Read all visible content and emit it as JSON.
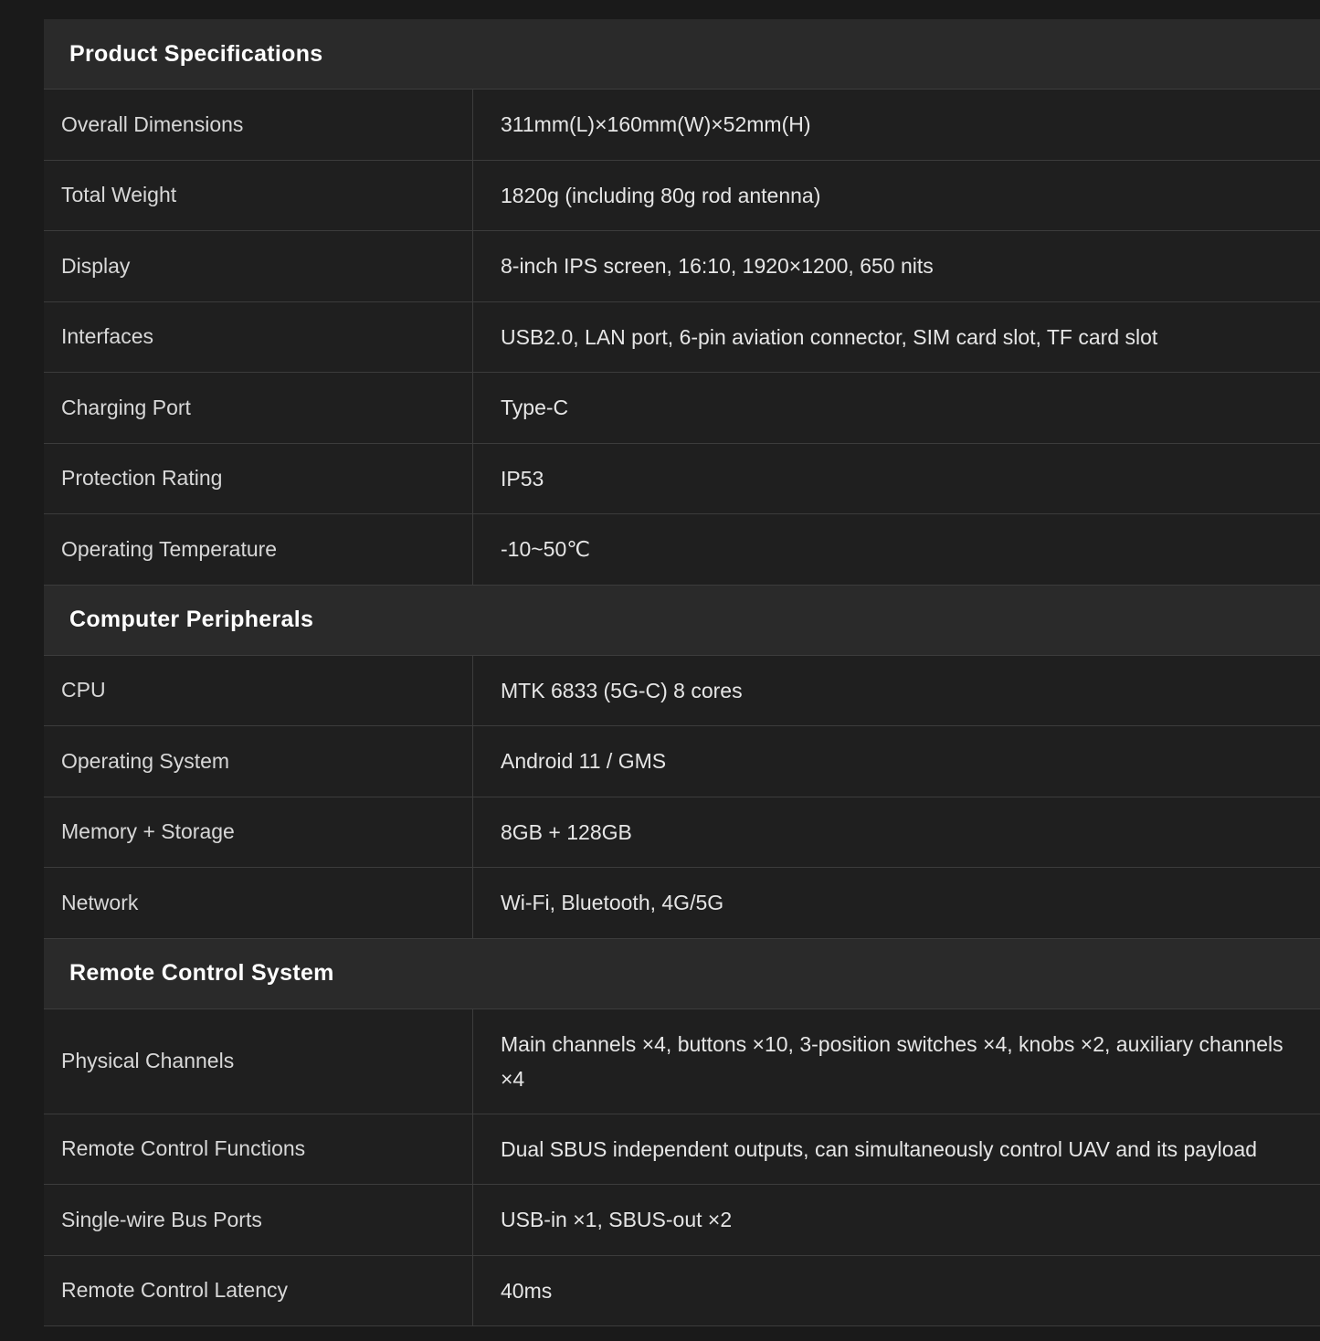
{
  "sections": [
    {
      "title": "Product Specifications",
      "rows": [
        {
          "label": "Overall Dimensions",
          "value": "311mm(L)×160mm(W)×52mm(H)"
        },
        {
          "label": "Total Weight",
          "value": "1820g (including 80g rod antenna)"
        },
        {
          "label": "Display",
          "value": "8-inch IPS screen, 16:10, 1920×1200, 650 nits"
        },
        {
          "label": "Interfaces",
          "value": "USB2.0, LAN port, 6-pin aviation connector, SIM card slot, TF card slot"
        },
        {
          "label": "Charging Port",
          "value": "Type-C"
        },
        {
          "label": "Protection Rating",
          "value": "IP53"
        },
        {
          "label": "Operating Temperature",
          "value": "-10~50℃"
        }
      ]
    },
    {
      "title": "Computer Peripherals",
      "rows": [
        {
          "label": "CPU",
          "value": "MTK 6833 (5G-C) 8 cores"
        },
        {
          "label": "Operating System",
          "value": "Android 11 / GMS"
        },
        {
          "label": "Memory + Storage",
          "value": "8GB + 128GB"
        },
        {
          "label": "Network",
          "value": "Wi-Fi, Bluetooth, 4G/5G"
        }
      ]
    },
    {
      "title": "Remote Control System",
      "rows": [
        {
          "label": "Physical Channels",
          "value": "Main channels ×4, buttons ×10, 3-position switches ×4, knobs ×2, auxiliary channels ×4"
        },
        {
          "label": "Remote Control Functions",
          "value": "Dual SBUS independent outputs, can simultaneously control UAV and its payload"
        },
        {
          "label": "Single-wire Bus Ports",
          "value": "USB-in ×1, SBUS-out ×2"
        },
        {
          "label": "Remote Control Latency",
          "value": "40ms"
        }
      ]
    }
  ]
}
